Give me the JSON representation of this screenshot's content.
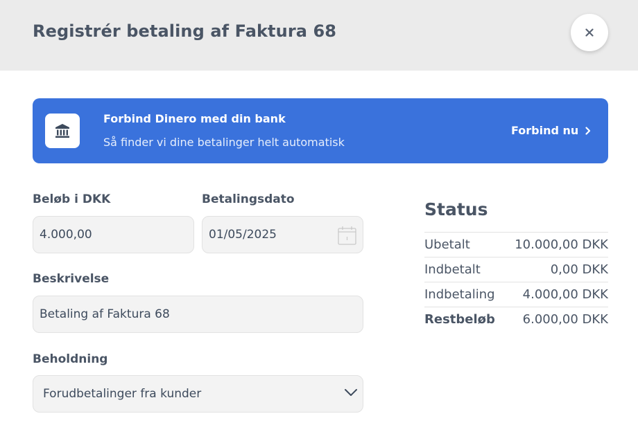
{
  "modal": {
    "title": "Registrér betaling af Faktura 68",
    "close_label": "×"
  },
  "bank_banner": {
    "title": "Forbind Dinero med din bank",
    "subtitle": "Så finder vi dine betalinger helt automatisk",
    "cta": "Forbind nu",
    "color": "#3a72dc"
  },
  "form": {
    "amount": {
      "label": "Beløb i DKK",
      "value": "4.000,00"
    },
    "date": {
      "label": "Betalingsdato",
      "value": "01/05/2025"
    },
    "description": {
      "label": "Beskrivelse",
      "value": "Betaling af Faktura 68"
    },
    "account": {
      "label": "Beholdning",
      "value": "Forudbetalinger fra kunder"
    }
  },
  "status": {
    "title": "Status",
    "rows": [
      {
        "label": "Ubetalt",
        "value": "10.000,00 DKK"
      },
      {
        "label": "Indbetalt",
        "value": "0,00 DKK"
      },
      {
        "label": "Indbetaling",
        "value": "4.000,00 DKK"
      },
      {
        "label": "Restbeløb",
        "value": "6.000,00 DKK"
      }
    ]
  }
}
